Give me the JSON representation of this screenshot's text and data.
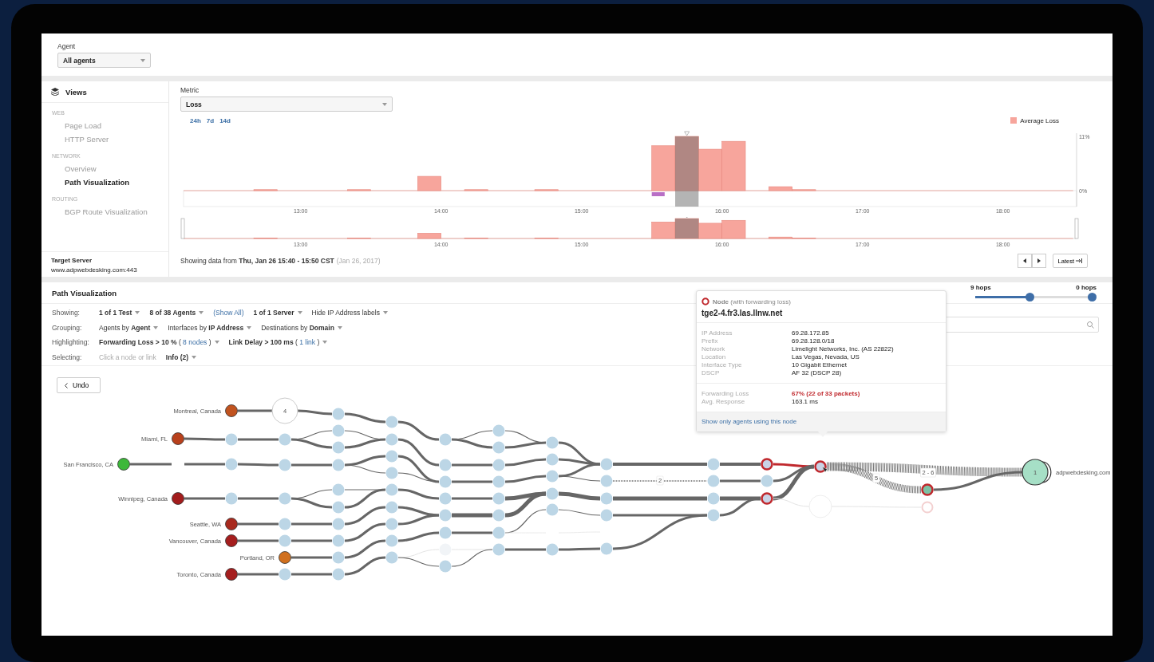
{
  "agent_filter": {
    "label": "Agent",
    "value": "All agents"
  },
  "sidebar": {
    "title": "Views",
    "groups": [
      {
        "heading": "WEB",
        "items": [
          {
            "label": "Page Load",
            "selected": false
          },
          {
            "label": "HTTP Server",
            "selected": false
          }
        ]
      },
      {
        "heading": "NETWORK",
        "items": [
          {
            "label": "Overview",
            "selected": false
          },
          {
            "label": "Path Visualization",
            "selected": true
          }
        ]
      },
      {
        "heading": "ROUTING",
        "items": [
          {
            "label": "BGP Route Visualization",
            "selected": false
          }
        ]
      }
    ],
    "target": {
      "label": "Target Server",
      "value": "www.adpwebdesking.com:443"
    }
  },
  "metric": {
    "label": "Metric",
    "value": "Loss",
    "ranges": [
      "24h",
      "7d",
      "14d"
    ],
    "chart_data": {
      "type": "bar",
      "x": [
        765,
        805,
        835,
        855,
        885,
        935,
        945,
        955,
        965,
        985,
        995
      ],
      "series": [
        {
          "name": "Average Loss",
          "color": "#f7a59c",
          "values": [
            0.2,
            0.2,
            2.9,
            0.2,
            0.2,
            9.1,
            11,
            8.4,
            10,
            0.8,
            0.2
          ]
        }
      ],
      "xlim": [
        730,
        1110
      ],
      "ylim": [
        0,
        11
      ],
      "yticks": [
        {
          "value": 0,
          "label": "0%"
        },
        {
          "value": 11,
          "label": "11%"
        }
      ],
      "xticks": [
        {
          "value": 780,
          "label": "13:00"
        },
        {
          "value": 840,
          "label": "14:00"
        },
        {
          "value": 900,
          "label": "15:00"
        },
        {
          "value": 960,
          "label": "16:00"
        },
        {
          "value": 1020,
          "label": "17:00"
        },
        {
          "value": 1080,
          "label": "18:00"
        }
      ]
    },
    "navigator": {
      "ticks": [
        "13:00",
        "14:00",
        "15:00",
        "16:00",
        "17:00",
        "18:00"
      ]
    },
    "summary": "Showing data from **Thu, Jan 26 15:40 - 15:50 CST**",
    "summary_note": "(Jan 26, 2017)",
    "latest": "Latest"
  },
  "path_view": {
    "title": "Path Visualization",
    "hops": {
      "start": "9 hops",
      "end": "0 hops",
      "level": 0.47
    },
    "filters": [
      {
        "label": "Showing:",
        "items": [
          {
            "kind": "dropdown",
            "text": "1 of 1 Test",
            "strong": true
          },
          {
            "kind": "dropdown",
            "text": "8 of 38 Agents",
            "strong": true
          },
          {
            "kind": "link",
            "text": "(Show All)"
          },
          {
            "kind": "dropdown",
            "text": "1 of 1 Server",
            "strong": true
          },
          {
            "kind": "dropdown",
            "text": "Hide IP Address labels",
            "strong": false
          }
        ]
      },
      {
        "label": "Grouping:",
        "items": [
          {
            "kind": "dropdown",
            "text": "Agents by **Agent**",
            "strong": false
          },
          {
            "kind": "dropdown",
            "text": "Interfaces by **IP Address**",
            "strong": false
          },
          {
            "kind": "dropdown",
            "text": "Destinations by **Domain**",
            "strong": false
          }
        ]
      },
      {
        "label": "Highlighting:",
        "items": [
          {
            "kind": "dropdown",
            "text": "**Forwarding Loss > 10 %** (",
            "link": "8 nodes",
            "after": ")",
            "strong": false
          },
          {
            "kind": "dropdown",
            "text": "**Link Delay > 100 ms** (",
            "link": "1 link",
            "after": ")",
            "strong": false
          }
        ]
      },
      {
        "label": "Selecting:",
        "items": [
          {
            "kind": "hint",
            "text": "Click a node or link"
          },
          {
            "kind": "dropdown",
            "text": "Info (2)",
            "strong": true
          }
        ]
      }
    ],
    "undo": "Undo",
    "graph": {
      "agents": [
        {
          "name": "Montreal, Canada",
          "color": "#c1531f"
        },
        {
          "name": "Miami, FL",
          "color": "#b8401c"
        },
        {
          "name": "San Francisco, CA",
          "color": "#3db83a"
        },
        {
          "name": "Winnipeg, Canada",
          "color": "#a21c1c"
        },
        {
          "name": "Seattle, WA",
          "color": "#a82a1e"
        },
        {
          "name": "Vancouver, Canada",
          "color": "#a51e1e"
        },
        {
          "name": "Portland, OR",
          "color": "#d0701f"
        },
        {
          "name": "Toronto, Canada",
          "color": "#a51e1e"
        }
      ],
      "group_count": "4",
      "link_labels": [
        "2",
        "2 - 6",
        "5"
      ],
      "destination": {
        "name": "adpwebdesking.com",
        "count": "1"
      }
    },
    "tooltip": {
      "kind_label": "Node",
      "kind_note": "(with forwarding loss)",
      "title": "tge2-4.fr3.las.llnw.net",
      "details": [
        {
          "key": "IP Address",
          "value": "69.28.172.85"
        },
        {
          "key": "Prefix",
          "value": "69.28.128.0/18"
        },
        {
          "key": "Network",
          "value": "Limelight Networks, Inc. (AS 22822)"
        },
        {
          "key": "Location",
          "value": "Las Vegas, Nevada, US"
        },
        {
          "key": "Interface Type",
          "value": "10 Gigabit Ethernet"
        },
        {
          "key": "DSCP",
          "value": "AF 32 (DSCP 28)"
        }
      ],
      "metrics": [
        {
          "key": "Forwarding Loss",
          "value": "67% (22 of 33 packets)",
          "alert": true
        },
        {
          "key": "Avg. Response",
          "value": "163.1 ms",
          "alert": false
        }
      ],
      "action": "Show only agents using this node"
    }
  }
}
